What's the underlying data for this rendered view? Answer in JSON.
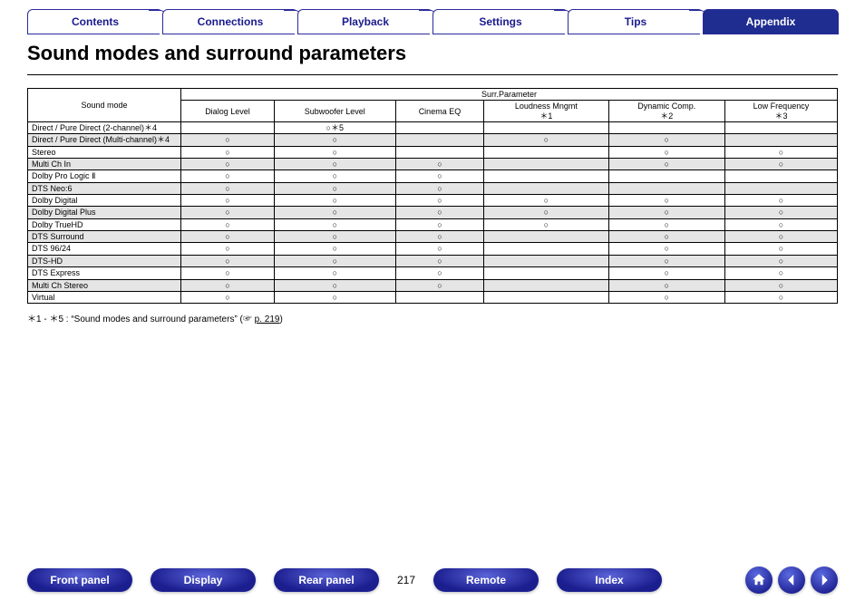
{
  "nav": {
    "tabs": [
      "Contents",
      "Connections",
      "Playback",
      "Settings",
      "Tips",
      "Appendix"
    ],
    "active_index": 5
  },
  "title": "Sound modes and surround parameters",
  "table": {
    "row_header": "Sound mode",
    "group_header": "Surr.Parameter",
    "columns": [
      "Dialog Level",
      "Subwoofer Level",
      "Cinema EQ",
      "Loudness Mngmt\n＊1",
      "Dynamic Comp.\n＊2",
      "Low Frequency\n＊3"
    ],
    "rows": [
      {
        "label": "Direct / Pure Direct (2-channel)＊4",
        "cells": [
          "",
          "○＊5",
          "",
          "",
          "",
          ""
        ]
      },
      {
        "label": "Direct / Pure Direct (Multi-channel)＊4",
        "cells": [
          "○",
          "○",
          "",
          "○",
          "○",
          ""
        ]
      },
      {
        "label": "Stereo",
        "cells": [
          "○",
          "○",
          "",
          "",
          "○",
          "○"
        ]
      },
      {
        "label": "Multi Ch In",
        "cells": [
          "○",
          "○",
          "○",
          "",
          "○",
          "○"
        ]
      },
      {
        "label": "Dolby Pro Logic Ⅱ",
        "cells": [
          "○",
          "○",
          "○",
          "",
          "",
          ""
        ]
      },
      {
        "label": "DTS Neo:6",
        "cells": [
          "○",
          "○",
          "○",
          "",
          "",
          ""
        ]
      },
      {
        "label": "Dolby Digital",
        "cells": [
          "○",
          "○",
          "○",
          "○",
          "○",
          "○"
        ]
      },
      {
        "label": "Dolby Digital Plus",
        "cells": [
          "○",
          "○",
          "○",
          "○",
          "○",
          "○"
        ]
      },
      {
        "label": "Dolby TrueHD",
        "cells": [
          "○",
          "○",
          "○",
          "○",
          "○",
          "○"
        ]
      },
      {
        "label": "DTS Surround",
        "cells": [
          "○",
          "○",
          "○",
          "",
          "○",
          "○"
        ]
      },
      {
        "label": "DTS 96/24",
        "cells": [
          "○",
          "○",
          "○",
          "",
          "○",
          "○"
        ]
      },
      {
        "label": "DTS-HD",
        "cells": [
          "○",
          "○",
          "○",
          "",
          "○",
          "○"
        ]
      },
      {
        "label": "DTS Express",
        "cells": [
          "○",
          "○",
          "○",
          "",
          "○",
          "○"
        ]
      },
      {
        "label": "Multi Ch Stereo",
        "cells": [
          "○",
          "○",
          "○",
          "",
          "○",
          "○"
        ]
      },
      {
        "label": "Virtual",
        "cells": [
          "○",
          "○",
          "",
          "",
          "○",
          "○"
        ]
      }
    ]
  },
  "footnote": {
    "prefix": "＊1 - ＊5 : “Sound modes and surround parameters” (☞ ",
    "link": "p. 219",
    "suffix": ")"
  },
  "bottom": {
    "buttons": [
      "Front panel",
      "Display",
      "Rear panel"
    ],
    "page": "217",
    "buttons2": [
      "Remote",
      "Index"
    ]
  }
}
